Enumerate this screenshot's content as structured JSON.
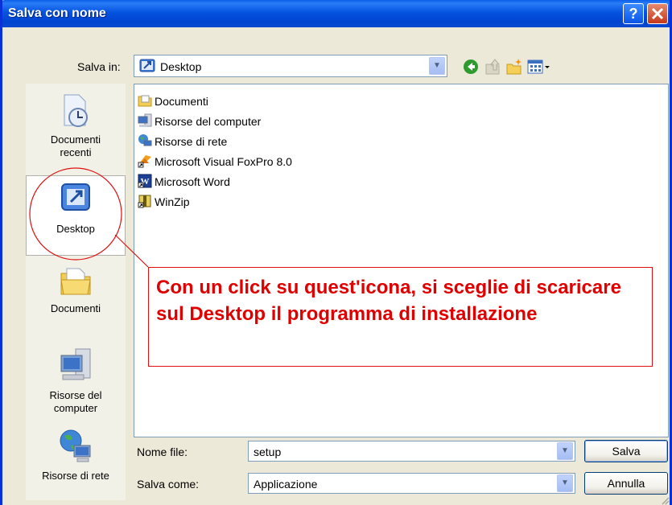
{
  "window": {
    "title": "Salva con nome",
    "help": "?",
    "close": "X"
  },
  "save_in": {
    "label": "Salva in:",
    "value": "Desktop"
  },
  "toolbar": {
    "back_icon": "back-arrow-icon",
    "up_icon": "up-folder-icon",
    "new_folder_icon": "new-folder-icon",
    "views_icon": "views-menu-icon"
  },
  "places": [
    {
      "label1": "Documenti",
      "label2": "recenti",
      "icon": "recent-documents-icon"
    },
    {
      "label1": "Desktop",
      "label2": "",
      "icon": "desktop-icon"
    },
    {
      "label1": "Documenti",
      "label2": "",
      "icon": "my-documents-icon"
    },
    {
      "label1": "Risorse del",
      "label2": "computer",
      "icon": "my-computer-icon"
    },
    {
      "label1": "Risorse di rete",
      "label2": "",
      "icon": "network-places-icon"
    }
  ],
  "files": [
    {
      "name": "Documenti",
      "icon": "folder-icon"
    },
    {
      "name": "Risorse del computer",
      "icon": "computer-icon"
    },
    {
      "name": "Risorse di rete",
      "icon": "network-icon"
    },
    {
      "name": "Microsoft Visual FoxPro 8.0",
      "icon": "foxpro-shortcut-icon"
    },
    {
      "name": "Microsoft Word",
      "icon": "word-shortcut-icon"
    },
    {
      "name": "WinZip",
      "icon": "winzip-shortcut-icon"
    }
  ],
  "filename": {
    "label": "Nome file:",
    "value": "setup"
  },
  "savetype": {
    "label": "Salva come:",
    "value": "Applicazione"
  },
  "buttons": {
    "save": "Salva",
    "cancel": "Annulla"
  },
  "annotation": {
    "text": "Con un click su quest'icona, si sceglie di scaricare sul Desktop il programma di installazione",
    "color": "#e00000"
  },
  "colors": {
    "title_blue": "#0553e0",
    "border_blue": "#0831d9",
    "dialog_bg": "#ece9d8"
  }
}
